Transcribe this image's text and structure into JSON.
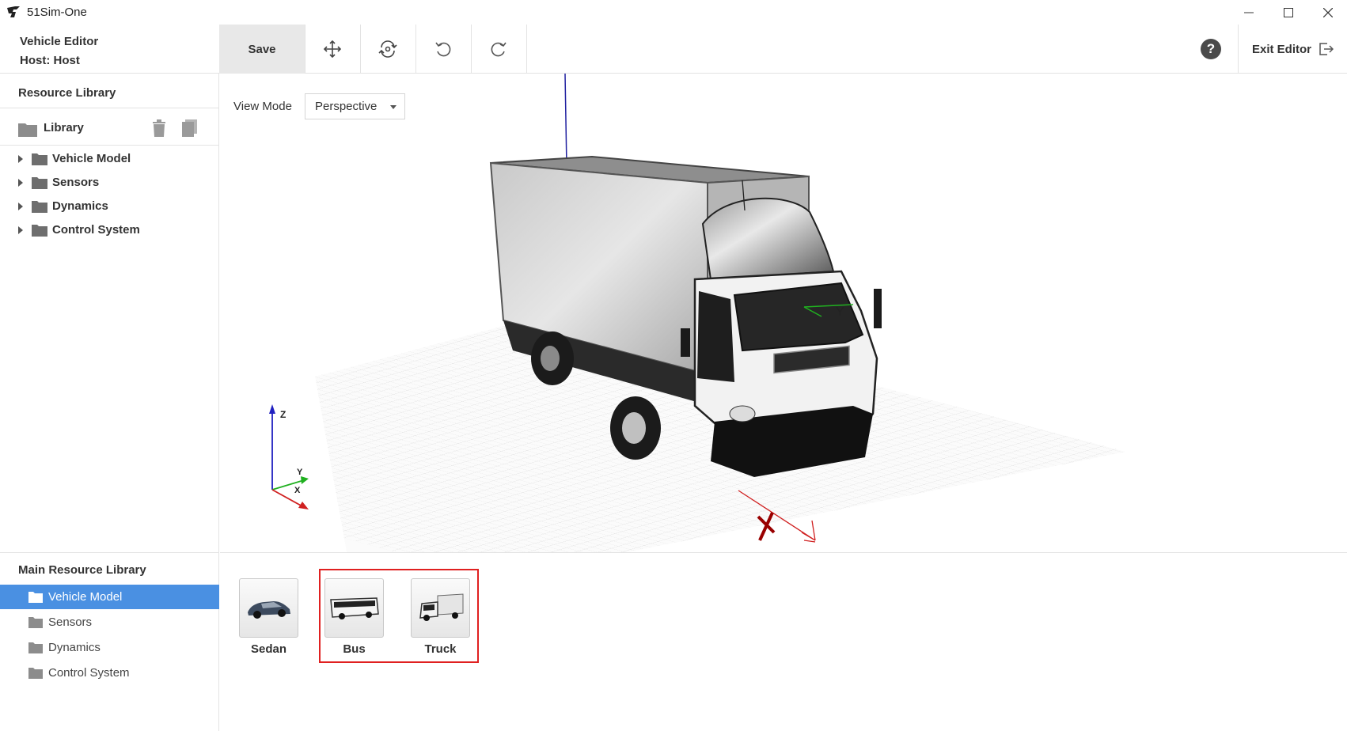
{
  "app": {
    "title": "51Sim-One"
  },
  "toolbar": {
    "editor_title": "Vehicle Editor",
    "host": "Host: Host",
    "save_label": "Save",
    "help_label": "?",
    "exit_label": "Exit Editor"
  },
  "resource_library": {
    "header": "Resource Library",
    "library_label": "Library",
    "items": [
      {
        "label": "Vehicle Model"
      },
      {
        "label": "Sensors"
      },
      {
        "label": "Dynamics"
      },
      {
        "label": "Control System"
      }
    ]
  },
  "main_library": {
    "header": "Main Resource Library",
    "items": [
      {
        "label": "Vehicle Model",
        "selected": true
      },
      {
        "label": "Sensors"
      },
      {
        "label": "Dynamics"
      },
      {
        "label": "Control System"
      }
    ]
  },
  "viewport": {
    "view_mode_label": "View Mode",
    "view_mode_value": "Perspective",
    "axis_labels": {
      "z": "Z",
      "y": "Y",
      "x": "X"
    }
  },
  "assets": [
    {
      "label": "Sedan",
      "icon": "sedan-icon"
    },
    {
      "label": "Bus",
      "icon": "bus-icon"
    },
    {
      "label": "Truck",
      "icon": "truck-icon"
    }
  ],
  "colors": {
    "selection": "#4a90e2",
    "highlight": "#e02020",
    "axis_x": "#d02020",
    "axis_y": "#20b020",
    "axis_z": "#2020c0"
  }
}
